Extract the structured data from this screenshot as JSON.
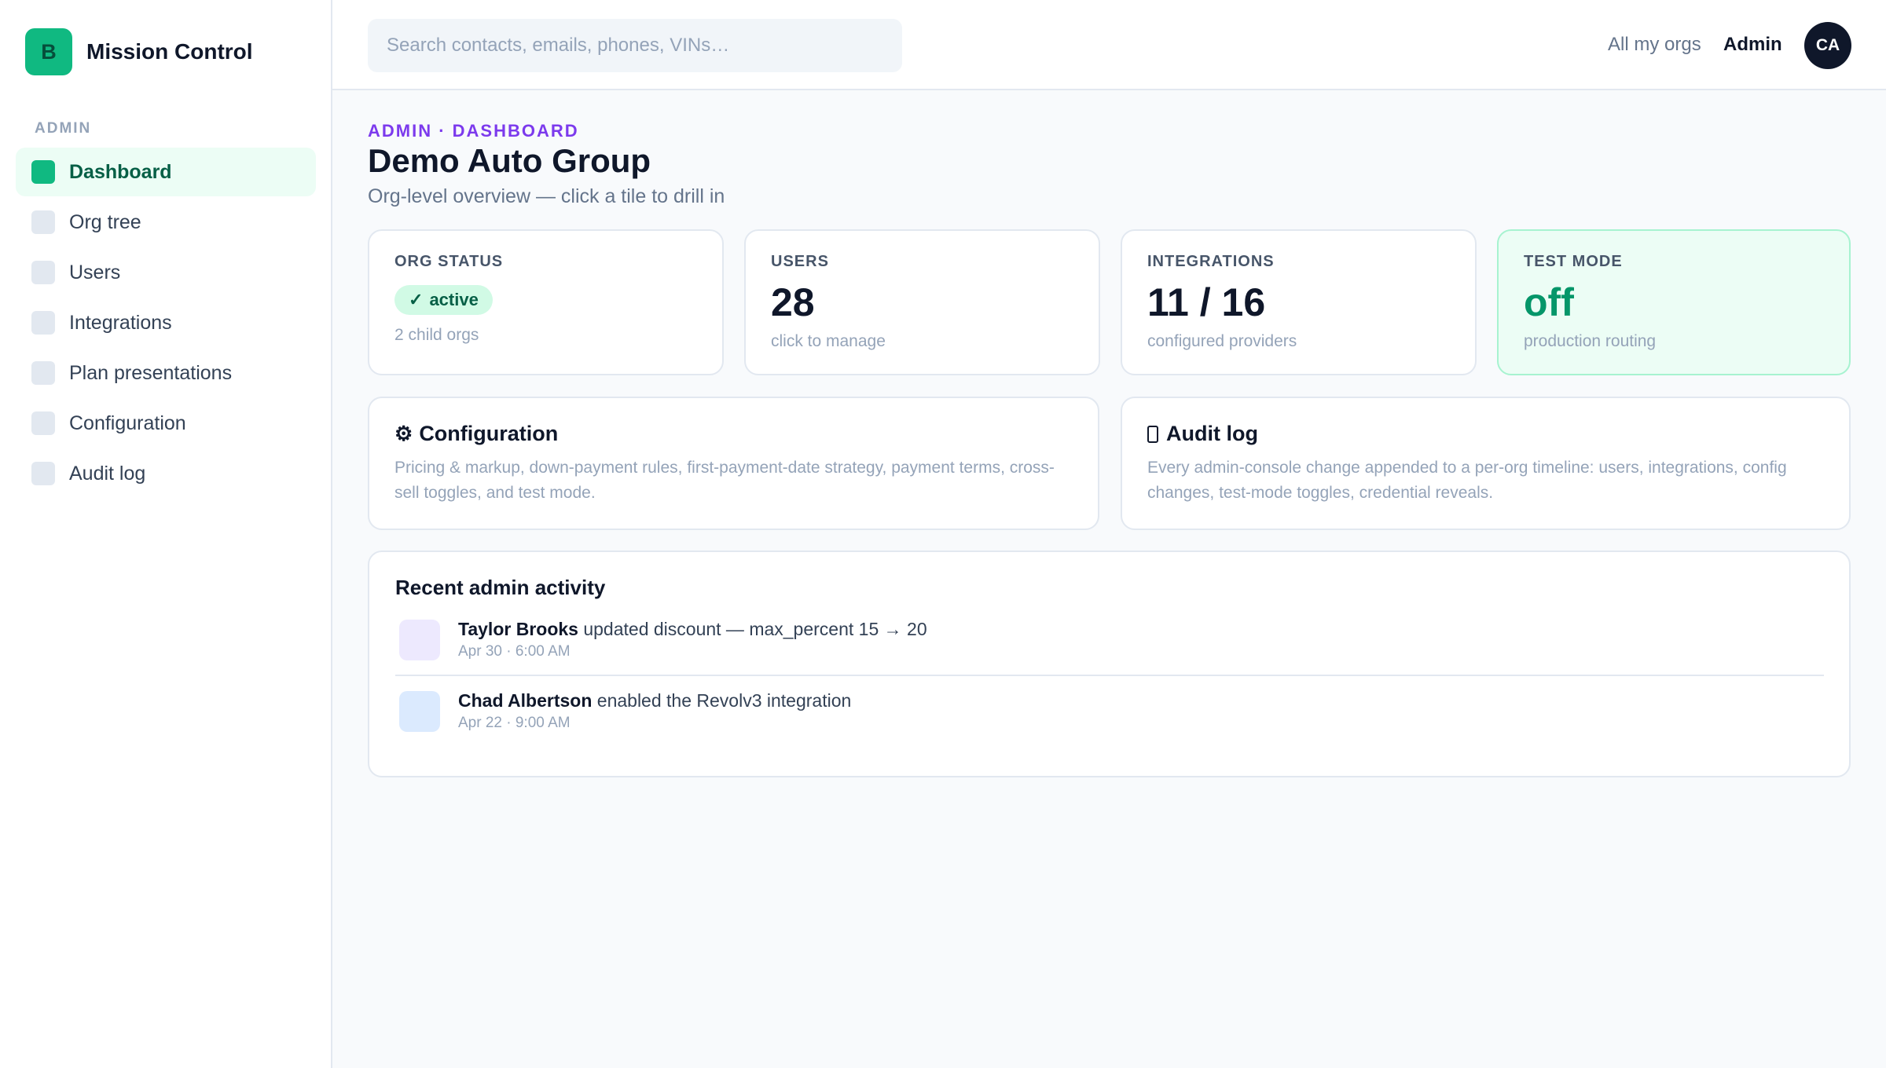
{
  "brand": {
    "logo_letter": "B",
    "name": "Mission Control"
  },
  "sidebar": {
    "section_label": "ADMIN",
    "items": [
      {
        "label": "Dashboard",
        "active": true
      },
      {
        "label": "Org tree"
      },
      {
        "label": "Users"
      },
      {
        "label": "Integrations"
      },
      {
        "label": "Plan presentations"
      },
      {
        "label": "Configuration"
      },
      {
        "label": "Audit log"
      }
    ]
  },
  "header": {
    "search_placeholder": "Search contacts, emails, phones, VINs…",
    "all_orgs": "All my orgs",
    "admin": "Admin",
    "avatar_initials": "CA"
  },
  "page": {
    "breadcrumb": "ADMIN · DASHBOARD",
    "title": "Demo Auto Group",
    "subtitle": "Org-level overview — click a tile to drill in"
  },
  "tiles": {
    "org_status": {
      "label": "ORG STATUS",
      "badge_icon": "✓",
      "badge": "active",
      "note": "2 child orgs"
    },
    "users": {
      "label": "USERS",
      "value": "28",
      "note": "click to manage"
    },
    "integrations": {
      "label": "INTEGRATIONS",
      "value": "11 / 16",
      "note": "configured providers"
    },
    "test_mode": {
      "label": "TEST MODE",
      "value": "off",
      "note": "production routing"
    }
  },
  "cards": {
    "configuration": {
      "icon": "⚙",
      "title": "Configuration",
      "description": "Pricing & markup, down-payment rules, first-payment-date strategy, payment terms, cross-sell toggles, and test mode."
    },
    "audit_log": {
      "icon": "clipboard-icon",
      "title": "Audit log",
      "description": "Every admin-console change appended to a per-org timeline: users, integrations, config changes, test-mode toggles, credential reveals."
    }
  },
  "activity": {
    "title": "Recent admin activity",
    "items": [
      {
        "actor": "Taylor Brooks",
        "action": " updated discount — max_percent 15 → 20",
        "time": "Apr 30 · 6:00 AM",
        "color": "#ede9fe"
      },
      {
        "actor": "Chad Albertson",
        "action": " enabled the Revolv3 integration",
        "time": "Apr 22 · 9:00 AM",
        "color": "#dbeafe"
      }
    ]
  },
  "colors": {
    "accent": "#10b981",
    "breadcrumb": "#7c3aed",
    "dark": "#0f172a"
  }
}
